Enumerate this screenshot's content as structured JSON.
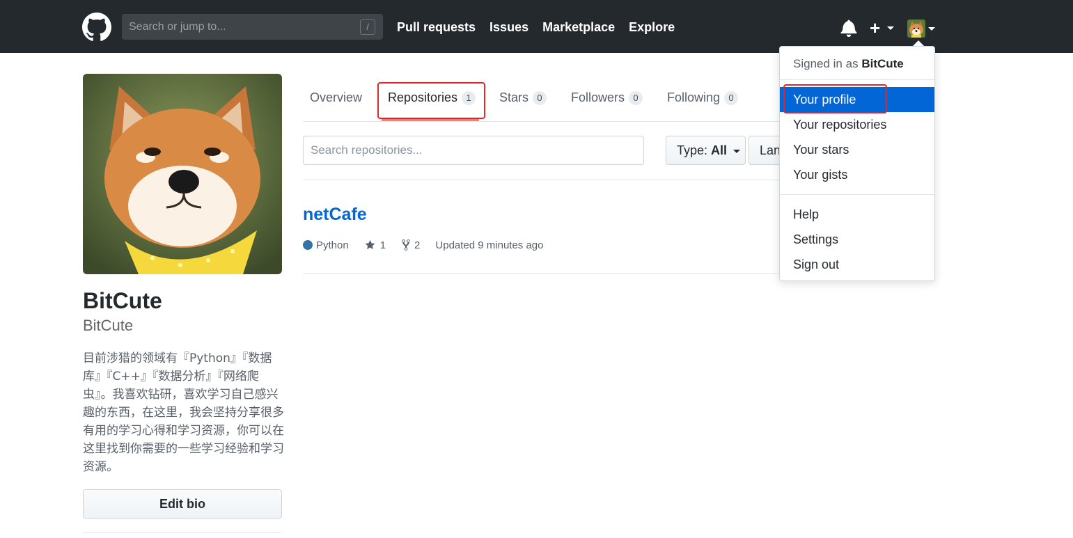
{
  "header": {
    "search_placeholder": "Search or jump to...",
    "search_shortcut": "/",
    "nav": [
      "Pull requests",
      "Issues",
      "Marketplace",
      "Explore"
    ],
    "plus_label": "+"
  },
  "profile": {
    "name": "BitCute",
    "login": "BitCute",
    "bio": "目前涉猎的领域有『Python』『数据库』『C++』『数据分析』『网络爬虫』。我喜欢钻研，喜欢学习自己感兴趣的东西，在这里，我会坚持分享很多有用的学习心得和学习资源，你可以在这里找到你需要的一些学习经验和学习资源。",
    "edit_bio_label": "Edit bio"
  },
  "tabs": [
    {
      "label": "Overview",
      "count": null
    },
    {
      "label": "Repositories",
      "count": "1"
    },
    {
      "label": "Stars",
      "count": "0"
    },
    {
      "label": "Followers",
      "count": "0"
    },
    {
      "label": "Following",
      "count": "0"
    }
  ],
  "filters": {
    "search_placeholder": "Search repositories...",
    "type_label": "Type:",
    "type_value": "All",
    "language_label": "Language"
  },
  "repo": {
    "name": "netCafe",
    "language": "Python",
    "language_color": "#3572a5",
    "stars": "1",
    "forks": "2",
    "updated": "Updated 9 minutes ago"
  },
  "dropdown": {
    "signed_in_prefix": "Signed in as",
    "signed_in_user": "BitCute",
    "group1": [
      "Your profile",
      "Your repositories",
      "Your stars",
      "Your gists"
    ],
    "group2": [
      "Help",
      "Settings",
      "Sign out"
    ]
  }
}
